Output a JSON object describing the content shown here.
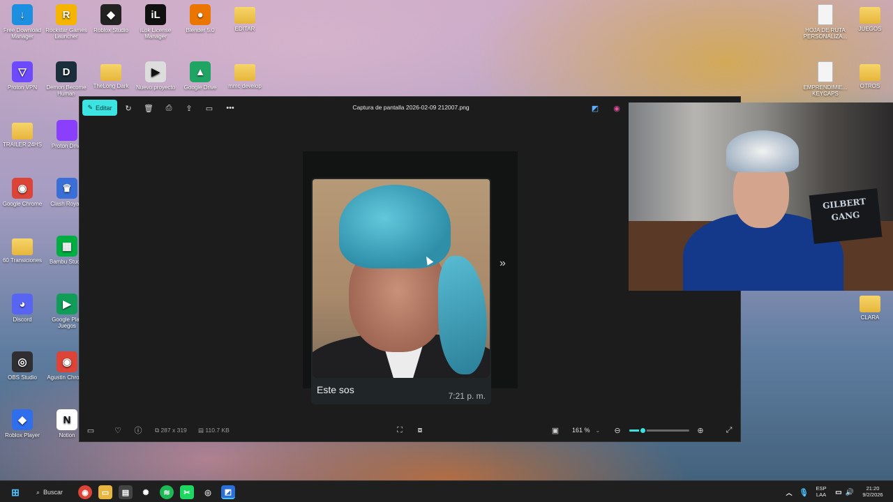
{
  "desktop": {
    "left_icons": [
      {
        "label": "Free Download Manager",
        "icon": "fdm-icon",
        "color": "#1d8fe0",
        "glyph": "↓"
      },
      {
        "label": "Rockstar Games Launcher",
        "icon": "rockstar-icon",
        "color": "#f4b400",
        "glyph": "R"
      },
      {
        "label": "Roblox Studio",
        "icon": "roblox-studio-icon",
        "color": "#222222",
        "glyph": "◆"
      },
      {
        "label": "iLok License Manager",
        "icon": "ilok-icon",
        "color": "#111111",
        "glyph": "iL"
      },
      {
        "label": "Blender 5.0",
        "icon": "blender-icon",
        "color": "#ea7600",
        "glyph": "●"
      },
      {
        "label": "EDITAR",
        "icon": "folder-icon",
        "color": "folder",
        "glyph": ""
      },
      {
        "label": "Proton VPN",
        "icon": "proton-vpn-icon",
        "color": "#6d4aff",
        "glyph": "▽"
      },
      {
        "label": "Demon Become Human",
        "icon": "game-icon",
        "color": "#1b2e3b",
        "glyph": "D"
      },
      {
        "label": "TheLong Dark",
        "icon": "folder-icon",
        "color": "folder",
        "glyph": ""
      },
      {
        "label": "Nuevo proyecto",
        "icon": "video-project-icon",
        "color": "#dddddd",
        "glyph": "▶"
      },
      {
        "label": "Google Drive",
        "icon": "google-drive-icon",
        "color": "#1fa463",
        "glyph": "▲"
      },
      {
        "label": "mmc develop",
        "icon": "folder-icon",
        "color": "folder",
        "glyph": ""
      },
      {
        "label": "TRAILER 24HS",
        "icon": "folder-icon",
        "color": "folder",
        "glyph": ""
      },
      {
        "label": "Proton Drive",
        "icon": "proton-drive-icon",
        "color": "#8a3ffc",
        "glyph": ""
      },
      {
        "label": "Google Chrome",
        "icon": "chrome-icon",
        "color": "#db4437",
        "glyph": "◉"
      },
      {
        "label": "Clash Royale",
        "icon": "clash-royale-icon",
        "color": "#3a6fd8",
        "glyph": "♛"
      },
      {
        "label": "60 Transiciones",
        "icon": "folder-icon",
        "color": "folder",
        "glyph": ""
      },
      {
        "label": "Bambu Studio",
        "icon": "bambu-icon",
        "color": "#00ae42",
        "glyph": "▦"
      },
      {
        "label": "Discord",
        "icon": "discord-icon",
        "color": "#5865f2",
        "glyph": "◕"
      },
      {
        "label": "Google Play Juegos",
        "icon": "play-games-icon",
        "color": "#0f9d58",
        "glyph": "▶"
      },
      {
        "label": "OBS Studio",
        "icon": "obs-icon",
        "color": "#302e31",
        "glyph": "◎"
      },
      {
        "label": "Agustin Chrome",
        "icon": "chrome-profile-icon",
        "color": "#db4437",
        "glyph": "◉"
      },
      {
        "label": "Roblox Player",
        "icon": "roblox-player-icon",
        "color": "#2f6fed",
        "glyph": "◆"
      },
      {
        "label": "Notion",
        "icon": "notion-icon",
        "color": "#ffffff",
        "glyph": "N"
      }
    ],
    "right_icons": [
      {
        "label": "HOJA DE RUTA PERSONALIZA...",
        "icon": "document-icon"
      },
      {
        "label": "JUEGOS",
        "icon": "folder-icon"
      },
      {
        "label": "EMPRENDIMIE... KEYCAPS",
        "icon": "document-icon"
      },
      {
        "label": "OTROS",
        "icon": "folder-icon"
      },
      {
        "label": "CLARA",
        "icon": "folder-icon"
      }
    ]
  },
  "photos_app": {
    "edit_label": "Editar",
    "title": "Captura de pantalla 2026-02-09 212007.png",
    "image": {
      "caption": "Este sos",
      "time": "7:21 p. m."
    },
    "status": {
      "dimensions": "287 x 319",
      "file_size": "110.7 KB",
      "zoom": "161 %",
      "zoom_level": 0.22
    },
    "accent_color": "#3be4e0"
  },
  "webcam": {
    "sign_line1": "GILBERT",
    "sign_line2": "GANG"
  },
  "taskbar": {
    "search_label": "Buscar",
    "lang_line1": "ESP",
    "lang_line2": "LAA",
    "time": "21:20",
    "date": "9/2/2026"
  }
}
